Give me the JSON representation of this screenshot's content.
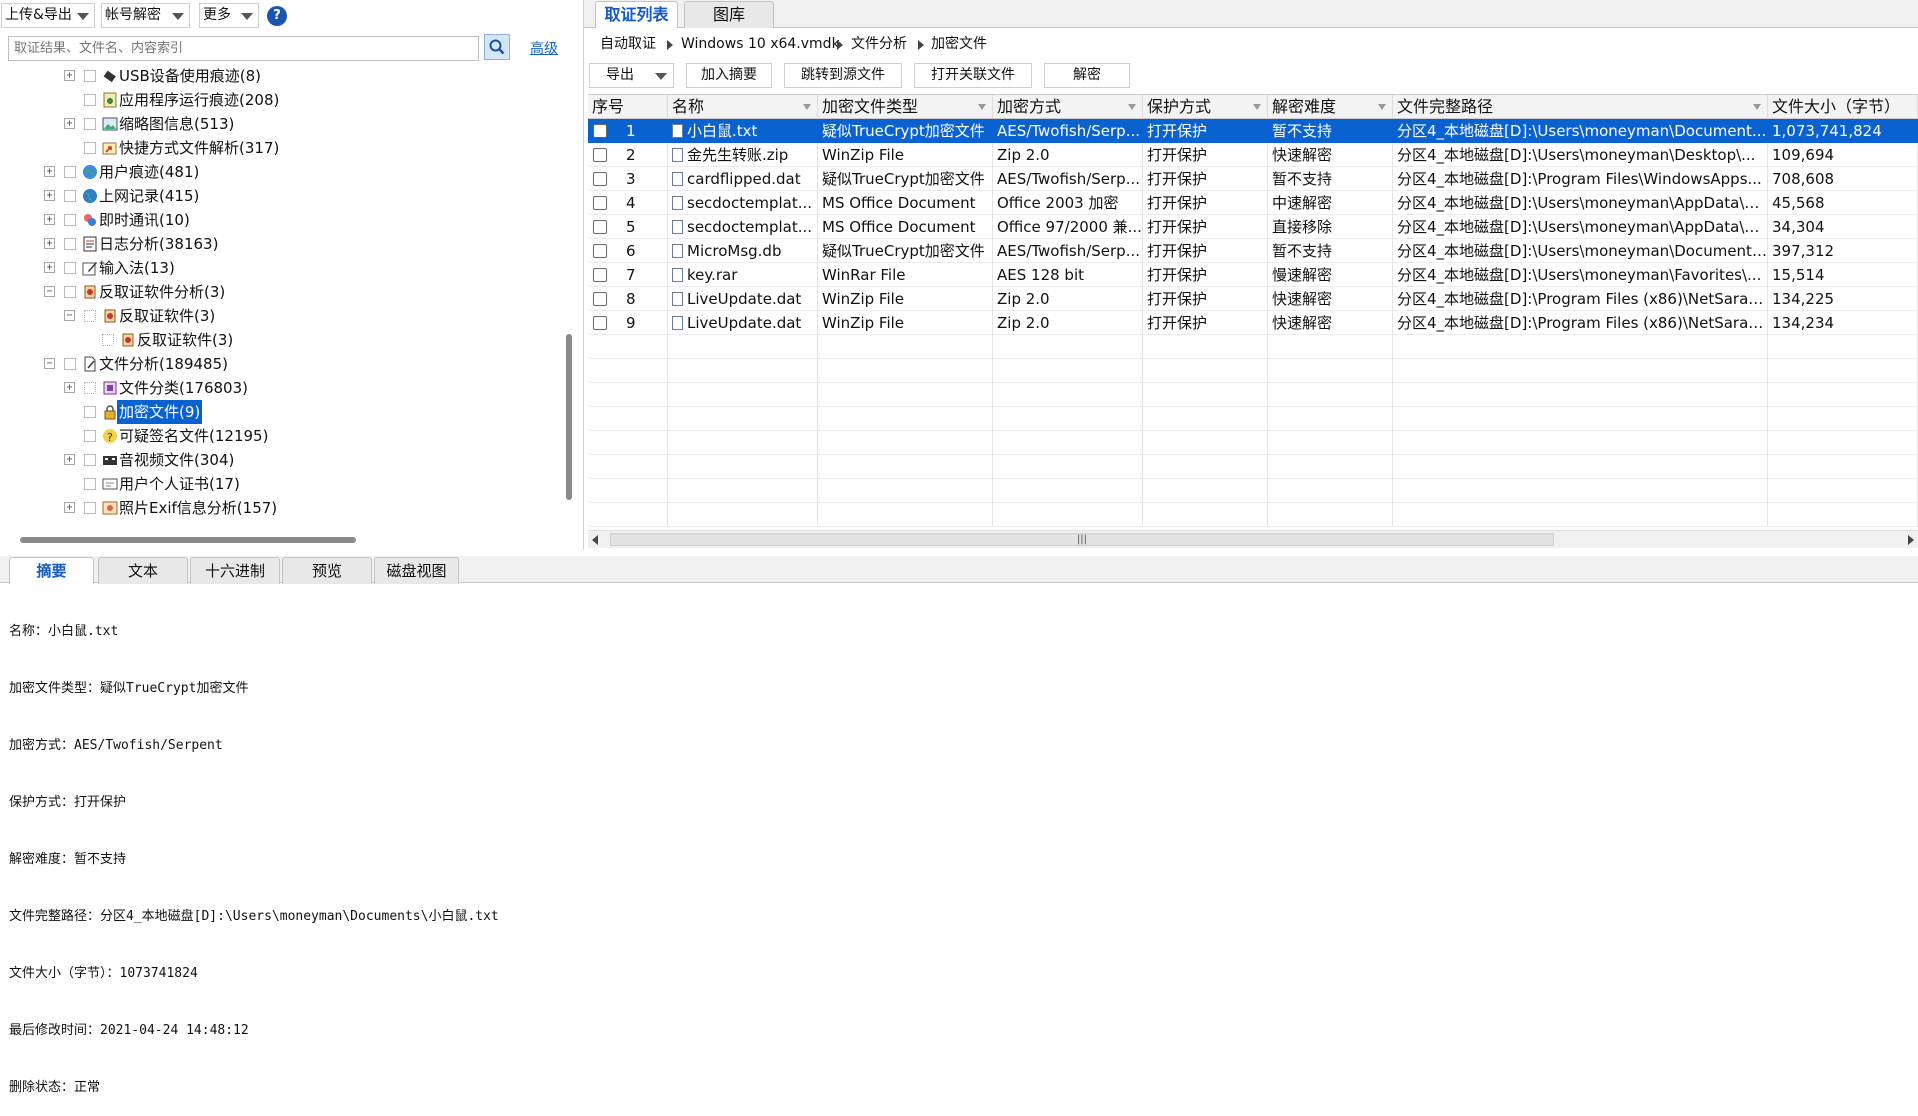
{
  "toolbar": {
    "upload_export": "上传&导出",
    "account_decrypt": "帐号解密",
    "more": "更多",
    "help": "?"
  },
  "search": {
    "placeholder": "取证结果、文件名、内容索引",
    "advanced": "高级"
  },
  "tree": [
    {
      "label": "USB设备使用痕迹(8)",
      "icon": "usb-icon"
    },
    {
      "label": "应用程序运行痕迹(208)",
      "icon": "app-icon"
    },
    {
      "label": "缩略图信息(513)",
      "icon": "image-icon"
    },
    {
      "label": "快捷方式文件解析(317)",
      "icon": "shortcut-icon"
    },
    {
      "label": "用户痕迹(481)",
      "icon": "globe-icon"
    },
    {
      "label": "上网记录(415)",
      "icon": "globe-icon"
    },
    {
      "label": "即时通讯(10)",
      "icon": "chat-icon"
    },
    {
      "label": "日志分析(38163)",
      "icon": "log-icon"
    },
    {
      "label": "输入法(13)",
      "icon": "pen-icon"
    },
    {
      "label": "反取证软件分析(3)",
      "icon": "tool-icon"
    },
    {
      "label": "反取证软件(3)",
      "icon": "tool-icon"
    },
    {
      "label": "反取证软件(3)",
      "icon": "tool-icon"
    },
    {
      "label": "文件分析(189485)",
      "icon": "file-icon"
    },
    {
      "label": "文件分类(176803)",
      "icon": "category-icon"
    },
    {
      "label": "加密文件(9)",
      "icon": "lock-icon"
    },
    {
      "label": "可疑签名文件(12195)",
      "icon": "question-icon"
    },
    {
      "label": "音视频文件(304)",
      "icon": "film-icon"
    },
    {
      "label": "用户个人证书(17)",
      "icon": "cert-icon"
    },
    {
      "label": "照片Exif信息分析(157)",
      "icon": "photo-icon"
    }
  ],
  "right_tabs": [
    "取证列表",
    "图库"
  ],
  "breadcrumb": [
    "自动取证",
    "Windows 10 x64.vmdk",
    "文件分析",
    "加密文件"
  ],
  "actions": {
    "export": "导出",
    "add_summary": "加入摘要",
    "jump_source": "跳转到源文件",
    "open_related": "打开关联文件",
    "decrypt": "解密"
  },
  "columns": [
    "序号",
    "名称",
    "加密文件类型",
    "加密方式",
    "保护方式",
    "解密难度",
    "文件完整路径",
    "文件大小（字节）"
  ],
  "rows": [
    [
      "1",
      "小白鼠.txt",
      "疑似TrueCrypt加密文件",
      "AES/Twofish/Serp...",
      "打开保护",
      "暂不支持",
      "分区4_本地磁盘[D]:\\Users\\moneyman\\Document...",
      "1,073,741,824"
    ],
    [
      "2",
      "金先生转账.zip",
      "WinZip File",
      "Zip 2.0",
      "打开保护",
      "快速解密",
      "分区4_本地磁盘[D]:\\Users\\moneyman\\Desktop\\...",
      "109,694"
    ],
    [
      "3",
      "cardflipped.dat",
      "疑似TrueCrypt加密文件",
      "AES/Twofish/Serp...",
      "打开保护",
      "暂不支持",
      "分区4_本地磁盘[D]:\\Program Files\\WindowsApps...",
      "708,608"
    ],
    [
      "4",
      "secdoctemplat...",
      "MS Office Document",
      "Office 2003 加密",
      "打开保护",
      "中速解密",
      "分区4_本地磁盘[D]:\\Users\\moneyman\\AppData\\Lo...",
      "45,568"
    ],
    [
      "5",
      "secdoctemplat...",
      "MS Office Document",
      "Office 97/2000 兼...",
      "打开保护",
      "直接移除",
      "分区4_本地磁盘[D]:\\Users\\moneyman\\AppData\\Lo...",
      "34,304"
    ],
    [
      "6",
      "MicroMsg.db",
      "疑似TrueCrypt加密文件",
      "AES/Twofish/Serp...",
      "打开保护",
      "暂不支持",
      "分区4_本地磁盘[D]:\\Users\\moneyman\\Documents...",
      "397,312"
    ],
    [
      "7",
      "key.rar",
      "WinRar File",
      "AES 128 bit",
      "打开保护",
      "慢速解密",
      "分区4_本地磁盘[D]:\\Users\\moneyman\\Favorites\\...",
      "15,514"
    ],
    [
      "8",
      "LiveUpdate.dat",
      "WinZip File",
      "Zip 2.0",
      "打开保护",
      "快速解密",
      "分区4_本地磁盘[D]:\\Program Files (x86)\\NetSaran...",
      "134,225"
    ],
    [
      "9",
      "LiveUpdate.dat",
      "WinZip File",
      "Zip 2.0",
      "打开保护",
      "快速解密",
      "分区4_本地磁盘[D]:\\Program Files (x86)\\NetSaran...",
      "134,234"
    ]
  ],
  "scroll_grip": "|||",
  "bottom_tabs": [
    "摘要",
    "文本",
    "十六进制",
    "预览",
    "磁盘视图"
  ],
  "detail": [
    "名称：小白鼠.txt",
    "加密文件类型：疑似TrueCrypt加密文件",
    "加密方式：AES/Twofish/Serpent",
    "保护方式：打开保护",
    "解密难度：暂不支持",
    "文件完整路径：分区4_本地磁盘[D]:\\Users\\moneyman\\Documents\\小白鼠.txt",
    "文件大小（字节）：1073741824",
    "最后修改时间：2021-04-24 14:48:12",
    "删除状态：正常"
  ],
  "colors": {
    "selection": "#0a62d1",
    "tab_active_text": "#1459c4",
    "link": "#1560c9"
  }
}
